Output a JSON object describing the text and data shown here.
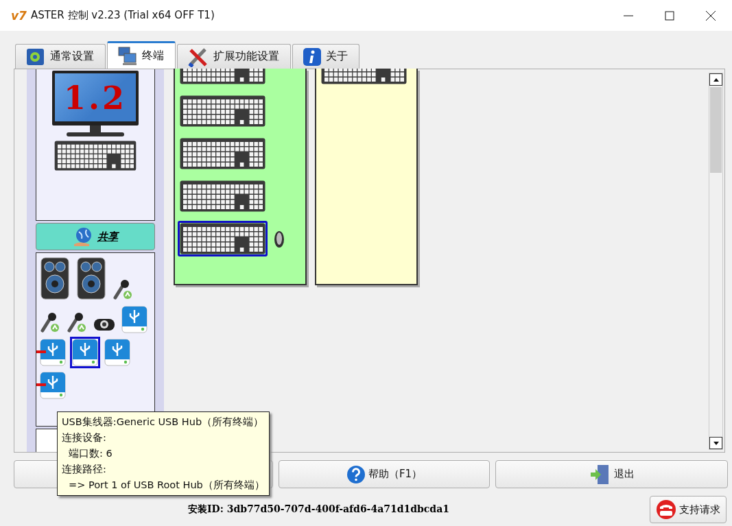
{
  "window": {
    "logo": "v7",
    "title": "ASTER 控制 v2.23 (Trial x64 OFF T1)"
  },
  "tabs": [
    {
      "label": "通常设置",
      "kind": "settings",
      "selected": false
    },
    {
      "label": "终端",
      "kind": "terminals",
      "selected": true
    },
    {
      "label": "扩展功能设置",
      "kind": "tools",
      "selected": false
    },
    {
      "label": "关于",
      "kind": "info",
      "selected": false
    }
  ],
  "terminal": {
    "number": "1.2"
  },
  "share_button": {
    "label": "共享"
  },
  "shared_devices": [
    {
      "kind": "speaker",
      "selected": false,
      "flagged": false
    },
    {
      "kind": "speaker",
      "selected": false,
      "flagged": false
    },
    {
      "kind": "microphone",
      "selected": false,
      "flagged": false
    },
    {
      "kind": "microphone",
      "selected": false,
      "flagged": false
    },
    {
      "kind": "microphone",
      "selected": false,
      "flagged": false
    },
    {
      "kind": "webcam",
      "selected": false,
      "flagged": false
    },
    {
      "kind": "usb",
      "selected": false,
      "flagged": false
    },
    {
      "kind": "usb",
      "selected": false,
      "flagged": true
    },
    {
      "kind": "usb",
      "selected": true,
      "flagged": false
    },
    {
      "kind": "usb",
      "selected": false,
      "flagged": false
    },
    {
      "kind": "usb",
      "selected": false,
      "flagged": true
    }
  ],
  "columns": [
    {
      "color": "#aaffa0",
      "devices": [
        {
          "kind": "keyboard",
          "selected": false
        },
        {
          "kind": "keyboard",
          "selected": false
        },
        {
          "kind": "keyboard",
          "selected": false
        },
        {
          "kind": "keyboard",
          "selected": false
        },
        {
          "kind": "keyboard",
          "selected": true
        },
        {
          "kind": "mouse",
          "selected": false
        }
      ]
    },
    {
      "color": "#ffffd0",
      "devices": [
        {
          "kind": "keyboard",
          "selected": false
        }
      ]
    }
  ],
  "tooltip": {
    "entries": [
      {
        "text": "USB集线器:Generic USB Hub（所有终端）"
      },
      {
        "text": "连接设备:",
        "children": [
          {
            "text": "端口数: 6"
          }
        ]
      },
      {
        "text": "连接路径:",
        "children": [
          {
            "text": "=> Port 1 of USB Root Hub（所有终端）"
          }
        ]
      }
    ]
  },
  "buttons": [
    {
      "kind": "plain"
    },
    {
      "kind": "help",
      "label": "帮助（F1）"
    },
    {
      "kind": "exit",
      "label": "退出"
    }
  ],
  "install_id": "安装ID: 3db77d50-707d-400f-afd6-4a71d1dbcda1",
  "support_button": {
    "label": "支持请求"
  }
}
